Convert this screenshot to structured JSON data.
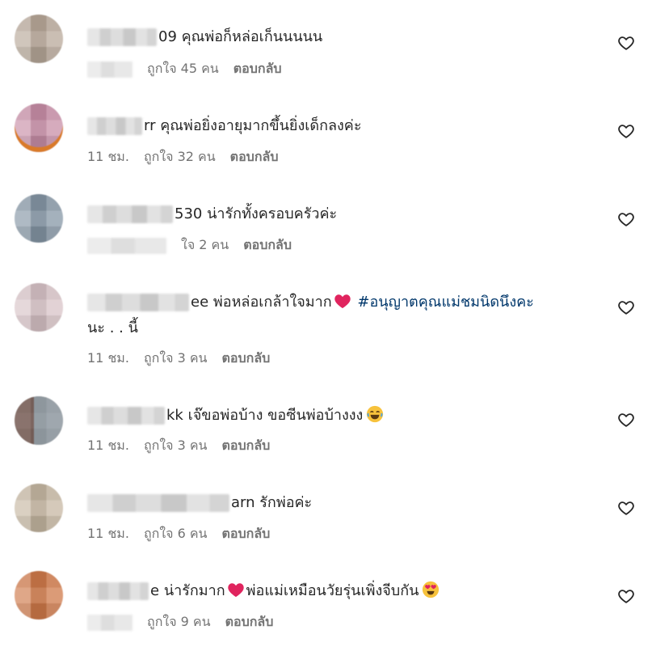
{
  "comments": [
    {
      "name_tail": "09",
      "text": "คุณพ่อก็หล่อเก็นนนนน",
      "time": "",
      "likes": "ถูกใจ 45 คน",
      "reply": "ตอบกลับ",
      "avatar_color": "#b9a99a",
      "like_icon": "heart-outline-icon"
    },
    {
      "name_tail": "rr",
      "text": "คุณพ่อยิ่งอายุมากขึ้นยิ่งเด็กลงค่ะ",
      "time": "11 ชม.",
      "likes": "ถูกใจ 32 คน",
      "reply": "ตอบกลับ",
      "avatar_color": "#c98fa8",
      "like_icon": "heart-outline-icon"
    },
    {
      "name_tail": "530",
      "text": "น่ารักทั้งครอบครัวค่ะ",
      "time": "",
      "likes": "ใจ 2 คน",
      "reply": "ตอบกลับ",
      "avatar_color": "#8697a6",
      "like_icon": "heart-outline-icon"
    },
    {
      "name_tail": "ee",
      "text_before": "พ่อหล่อเกล้าใจมาก",
      "hashtag": "#อนุญาตคุณแม่ชมนิดนึงคะ",
      "text_cont": "นะ . . นี้",
      "time": "11 ชม.",
      "likes": "ถูกใจ 3 คน",
      "reply": "ตอบกลับ",
      "avatar_color": "#d9c4c8",
      "like_icon": "heart-outline-icon"
    },
    {
      "name_tail": "kk",
      "text": "เจ๊ขอพ่อบ้าง ขอซีนพ่อบ้างงง",
      "time": "11 ชม.",
      "likes": "ถูกใจ 3 คน",
      "reply": "ตอบกลับ",
      "avatar_color": "#8a8a8a",
      "like_icon": "heart-outline-icon"
    },
    {
      "name_tail": "arn",
      "text": "รักพ่อค่ะ",
      "time": "11 ชม.",
      "likes": "ถูกใจ 6 คน",
      "reply": "ตอบกลับ",
      "avatar_color": "#c7b8a3",
      "like_icon": "heart-outline-icon"
    },
    {
      "name_tail": "e",
      "text_before": "น่ารักมาก",
      "text_after": "พ่อแม่เหมือนวัยรุ่นเพิ่งจีบกัน",
      "time": "",
      "likes": "ถูกใจ 9 คน",
      "reply": "ตอบกลับ",
      "avatar_color": "#d07a4a",
      "like_icon": "heart-outline-icon"
    }
  ],
  "colors": {
    "text": "#262626",
    "meta": "#737373",
    "hashtag": "#00376b",
    "red_heart": "#e0245e"
  }
}
